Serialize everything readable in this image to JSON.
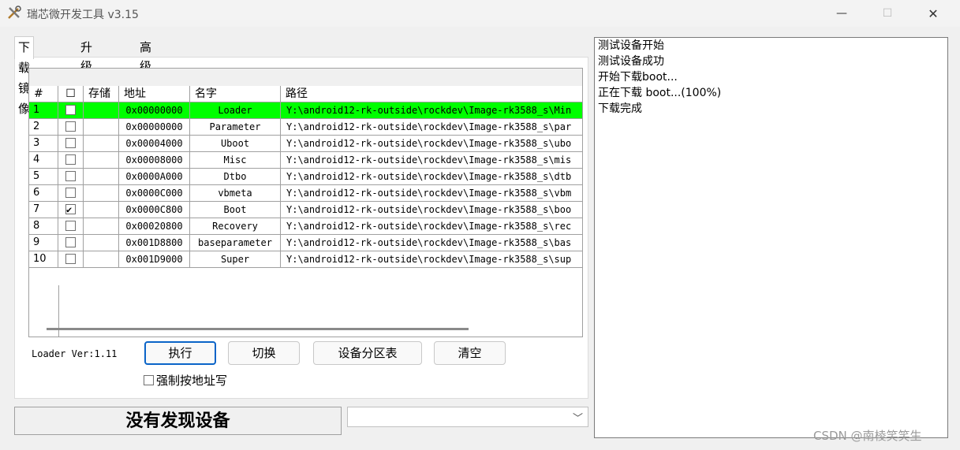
{
  "window": {
    "title": "瑞芯微开发工具 v3.15",
    "icon": "tools-icon",
    "controls": {
      "minimize": "—",
      "maximize": "☐",
      "close": "✕"
    }
  },
  "tabs": [
    {
      "label": "下载镜像",
      "active": true
    },
    {
      "label": "升级固件",
      "active": false
    },
    {
      "label": "高级功能",
      "active": false
    }
  ],
  "table": {
    "headers": {
      "num": "#",
      "check": "☐",
      "storage": "存储",
      "address": "地址",
      "name": "名字",
      "path": "路径"
    },
    "rows": [
      {
        "num": "1",
        "checked": false,
        "address": "0x00000000",
        "name": "Loader",
        "path": "Y:\\android12-rk-outside\\rockdev\\Image-rk3588_s\\Min",
        "selected": true
      },
      {
        "num": "2",
        "checked": false,
        "address": "0x00000000",
        "name": "Parameter",
        "path": "Y:\\android12-rk-outside\\rockdev\\Image-rk3588_s\\par"
      },
      {
        "num": "3",
        "checked": false,
        "address": "0x00004000",
        "name": "Uboot",
        "path": "Y:\\android12-rk-outside\\rockdev\\Image-rk3588_s\\ubo"
      },
      {
        "num": "4",
        "checked": false,
        "address": "0x00008000",
        "name": "Misc",
        "path": "Y:\\android12-rk-outside\\rockdev\\Image-rk3588_s\\mis"
      },
      {
        "num": "5",
        "checked": false,
        "address": "0x0000A000",
        "name": "Dtbo",
        "path": "Y:\\android12-rk-outside\\rockdev\\Image-rk3588_s\\dtb"
      },
      {
        "num": "6",
        "checked": false,
        "address": "0x0000C000",
        "name": "vbmeta",
        "path": "Y:\\android12-rk-outside\\rockdev\\Image-rk3588_s\\vbm"
      },
      {
        "num": "7",
        "checked": true,
        "address": "0x0000C800",
        "name": "Boot",
        "path": "Y:\\android12-rk-outside\\rockdev\\Image-rk3588_s\\boo"
      },
      {
        "num": "8",
        "checked": false,
        "address": "0x00020800",
        "name": "Recovery",
        "path": "Y:\\android12-rk-outside\\rockdev\\Image-rk3588_s\\rec"
      },
      {
        "num": "9",
        "checked": false,
        "address": "0x001D8800",
        "name": "baseparameter",
        "path": "Y:\\android12-rk-outside\\rockdev\\Image-rk3588_s\\bas"
      },
      {
        "num": "10",
        "checked": false,
        "address": "0x001D9000",
        "name": "Super",
        "path": "Y:\\android12-rk-outside\\rockdev\\Image-rk3588_s\\sup"
      }
    ],
    "selected_color": "#00ff00"
  },
  "loader_version": "Loader Ver:1.11",
  "buttons": {
    "execute": "执行",
    "switch": "切换",
    "partition_table": "设备分区表",
    "clear": "清空"
  },
  "force_address_write": {
    "label": "强制按地址写",
    "checked": false
  },
  "status_text": "没有发现设备",
  "device_combo": {
    "value": ""
  },
  "log_lines": [
    "测试设备开始",
    "测试设备成功",
    "开始下载boot...",
    "正在下载 boot...(100%)",
    "下载完成"
  ],
  "watermark": "CSDN @南棱笑笑生"
}
